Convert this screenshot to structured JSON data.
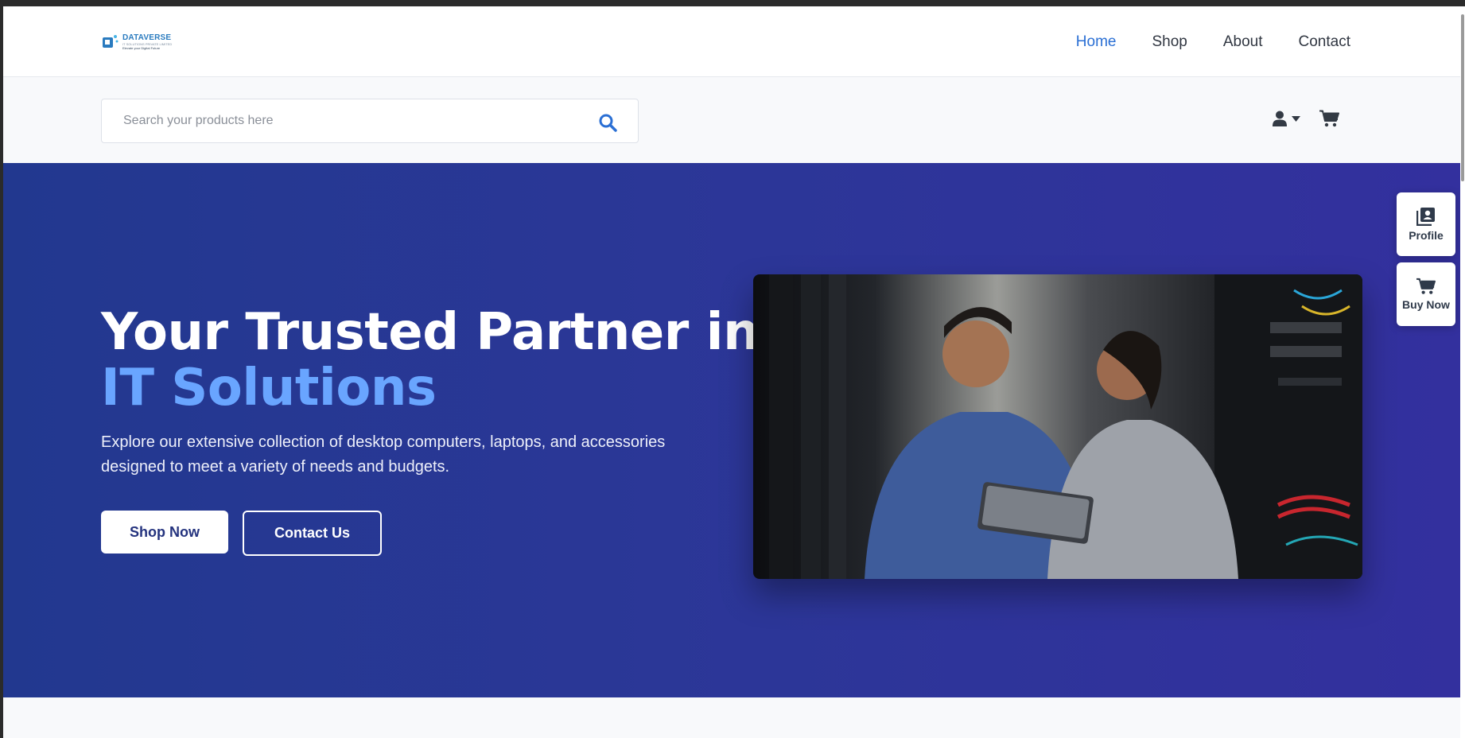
{
  "brand": {
    "name": "DATAVERSE",
    "subline": "IT SOLUTIONS PRIVATE LIMITED",
    "tagline": "Elevate your Digital Future"
  },
  "nav": {
    "items": [
      {
        "label": "Home",
        "active": true
      },
      {
        "label": "Shop",
        "active": false
      },
      {
        "label": "About",
        "active": false
      },
      {
        "label": "Contact",
        "active": false
      }
    ]
  },
  "search": {
    "placeholder": "Search your products here",
    "value": ""
  },
  "header_icons": [
    "user-icon",
    "caret-down-icon",
    "cart-icon"
  ],
  "hero": {
    "title_line1": "Your Trusted Partner in",
    "title_line2": "IT Solutions",
    "description": "Explore our extensive collection of desktop computers, laptops, and accessories designed to meet a variety of needs and budgets.",
    "primary_button": "Shop Now",
    "secondary_button": "Contact Us",
    "image": "two-it-professionals-with-tablet-in-server-room"
  },
  "floating": {
    "profile_label": "Profile",
    "buy_label": "Buy Now"
  },
  "colors": {
    "accent": "#2a6fd4",
    "hero_start": "#22388f",
    "hero_end": "#33309e",
    "highlight": "#69a5ff",
    "button_text": "#24337e"
  }
}
